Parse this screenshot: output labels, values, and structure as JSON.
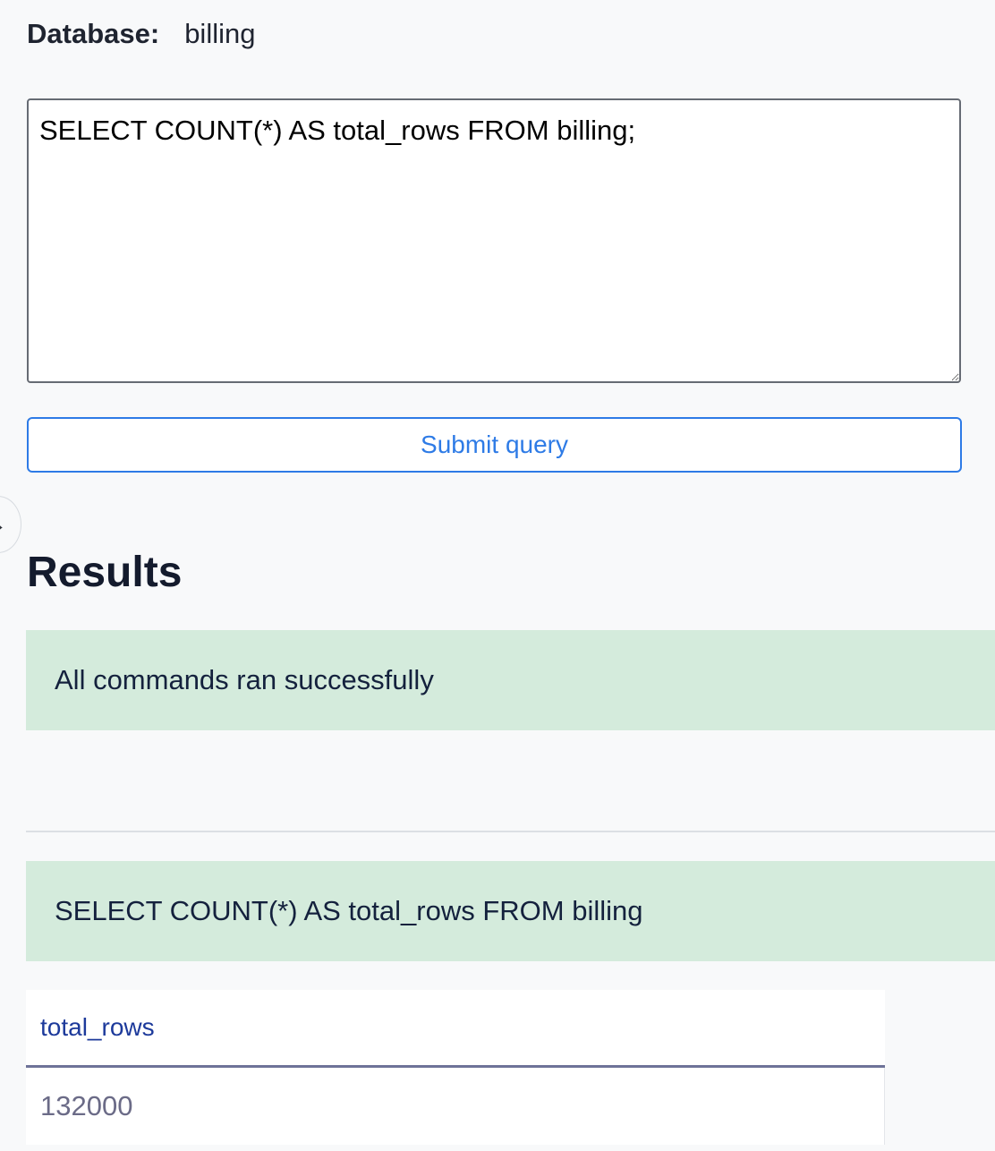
{
  "database": {
    "label": "Database:",
    "value": "billing"
  },
  "query_editor": {
    "value": "SELECT COUNT(*) AS total_rows FROM billing;"
  },
  "submit_button": {
    "label": "Submit query"
  },
  "side_toggle": {
    "icon": "arrow-right-icon",
    "glyph": "→"
  },
  "results": {
    "title": "Results",
    "status_message": "All commands ran successfully",
    "statements": [
      {
        "query": "SELECT COUNT(*) AS total_rows FROM billing",
        "columns": [
          "total_rows"
        ],
        "rows": [
          [
            "132000"
          ]
        ]
      }
    ]
  },
  "colors": {
    "accent": "#2e7be6",
    "success_bg": "#d4ebdc",
    "page_bg": "#f8f9fa",
    "table_header_text": "#1d3a9b"
  }
}
